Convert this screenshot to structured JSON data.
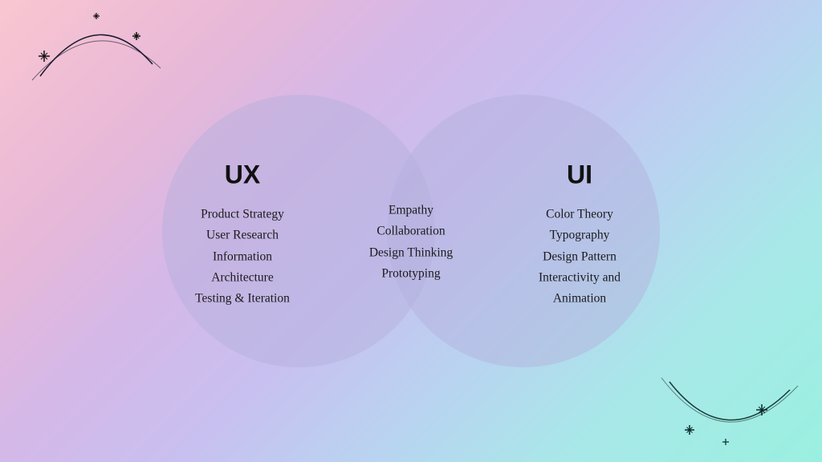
{
  "background": {
    "gradient_description": "pink to purple to cyan gradient"
  },
  "venn": {
    "left_title": "UX",
    "right_title": "UI",
    "left_items": [
      "Product Strategy",
      "User Research",
      "Information",
      "Architecture",
      "Testing & Iteration"
    ],
    "middle_items": [
      "Empathy",
      "Collaboration",
      "Design Thinking",
      "Prototyping"
    ],
    "right_items": [
      "Color Theory",
      "Typography",
      "Design Pattern",
      "Interactivity and",
      "Animation"
    ]
  },
  "decorations": {
    "top_left": "arc with stars",
    "bottom_right": "arc with stars"
  }
}
